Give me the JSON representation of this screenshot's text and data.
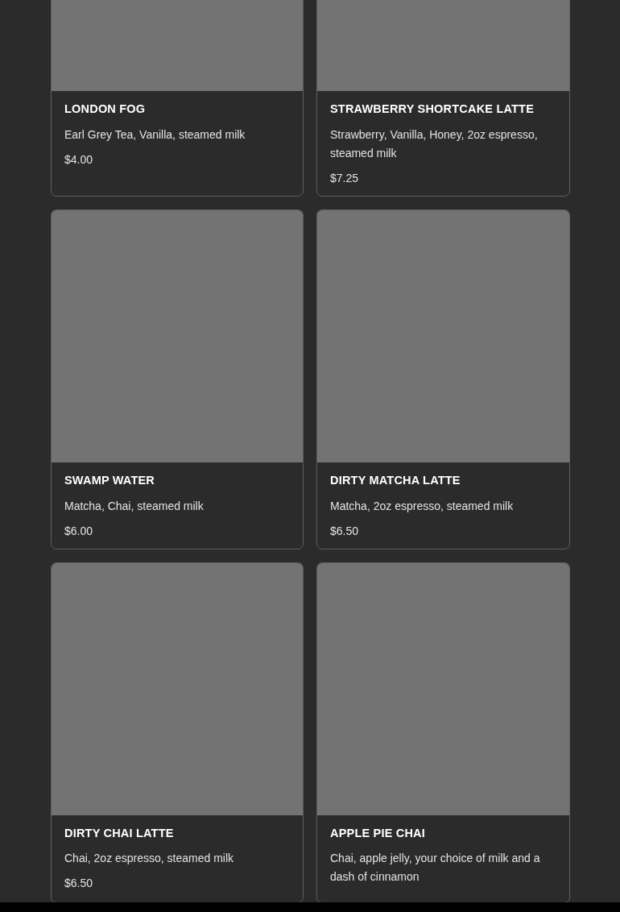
{
  "menu_items": [
    {
      "title": "LONDON FOG",
      "description": "Earl Grey Tea, Vanilla, steamed milk",
      "price": "$4.00"
    },
    {
      "title": "STRAWBERRY SHORTCAKE LATTE",
      "description": "Strawberry, Vanilla, Honey, 2oz espresso, steamed milk",
      "price": "$7.25"
    },
    {
      "title": "SWAMP WATER",
      "description": "Matcha, Chai, steamed milk",
      "price": "$6.00"
    },
    {
      "title": "DIRTY MATCHA LATTE",
      "description": "Matcha, 2oz espresso, steamed milk",
      "price": "$6.50"
    },
    {
      "title": "DIRTY CHAI LATTE",
      "description": "Chai, 2oz espresso, steamed milk",
      "price": "$6.50"
    },
    {
      "title": "APPLE PIE CHAI",
      "description": "Chai, apple jelly, your choice of milk and a dash of cinnamon"
    }
  ]
}
